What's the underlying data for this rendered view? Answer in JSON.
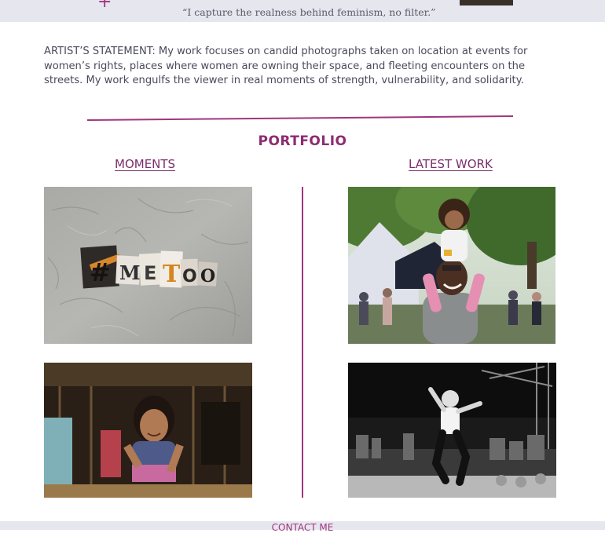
{
  "header": {
    "quote": "“I capture the realness behind feminism, no filter.”",
    "plus_glyph": "+"
  },
  "statement": {
    "text": "ARTIST’S STATEMENT:  My work focuses on candid photographs taken on location at events for women’s rights, places where women are owning their space, and fleeting encounters on the streets. My work engulfs the viewer in real moments of strength, vulnerability, and solidarity."
  },
  "portfolio": {
    "title": "PORTFOLIO",
    "columns": [
      {
        "heading": "MOMENTS"
      },
      {
        "heading": "LATEST WORK"
      }
    ],
    "metoo_letters": [
      "#",
      "M",
      "E",
      "T",
      "O",
      "O"
    ]
  },
  "footer": {
    "contact_label": "CONTACT ME"
  },
  "colors": {
    "accent": "#a0357f",
    "heading": "#8e2a72",
    "band": "#e6e6ee",
    "body_text": "#4a4a5c"
  }
}
